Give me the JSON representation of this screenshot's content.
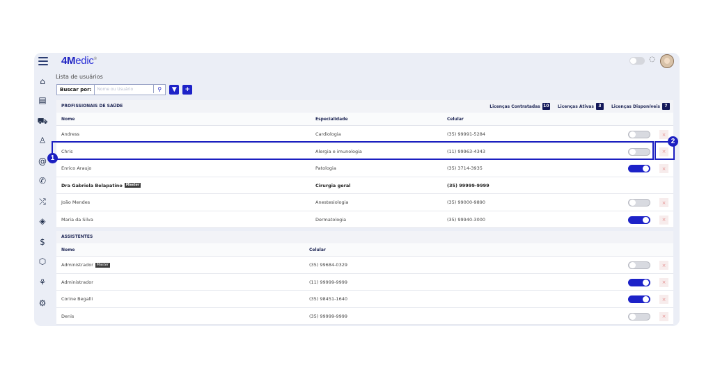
{
  "app": {
    "logo_bold": "4M",
    "logo_rest": "edic",
    "page_title": "Lista de usuários"
  },
  "sidebar": {
    "items": [
      {
        "icon": "home-icon",
        "glyph": "⌂"
      },
      {
        "icon": "calendar-icon",
        "glyph": "▤"
      },
      {
        "icon": "car-icon",
        "glyph": "⛟"
      },
      {
        "icon": "user-icon",
        "glyph": "♙"
      },
      {
        "icon": "at-icon",
        "glyph": "@"
      },
      {
        "icon": "phone-icon",
        "glyph": "✆"
      },
      {
        "icon": "shuffle-icon",
        "glyph": "⤮"
      },
      {
        "icon": "tag-icon",
        "glyph": "◈"
      },
      {
        "icon": "dollar-icon",
        "glyph": "$"
      },
      {
        "icon": "box-icon",
        "glyph": "⬡"
      },
      {
        "icon": "chart-icon",
        "glyph": "⚘"
      },
      {
        "icon": "settings-icon",
        "glyph": "⚙"
      }
    ]
  },
  "search": {
    "label": "Buscar por:",
    "placeholder": "Nome ou Usuário",
    "value": ""
  },
  "professionals": {
    "title": "PROFISSIONAIS DE SAÚDE",
    "licenses": [
      {
        "label": "Licenças Contratadas",
        "count": "10"
      },
      {
        "label": "Licenças Ativas",
        "count": "3"
      },
      {
        "label": "Licenças Disponíveis",
        "count": "7"
      }
    ],
    "columns": {
      "name": "Nome",
      "specialty": "Especialidade",
      "phone": "Celular"
    },
    "rows": [
      {
        "name": "Andress",
        "specialty": "Cardiologia",
        "phone": "(35) 99991-5284",
        "active": false,
        "master": false,
        "bold": false
      },
      {
        "name": "Chris",
        "specialty": "Alergia e imunologia",
        "phone": "(11) 99963-4343",
        "active": false,
        "master": false,
        "bold": false
      },
      {
        "name": "Enrico Araujo",
        "specialty": "Patologia",
        "phone": "(35) 3714-3935",
        "active": true,
        "master": false,
        "bold": false
      },
      {
        "name": "Dra Gabriela Belapatino",
        "specialty": "Cirurgia geral",
        "phone": "(35) 99999-9999",
        "active": null,
        "master": true,
        "bold": true
      },
      {
        "name": "João Mendes",
        "specialty": "Anestesiologia",
        "phone": "(35) 99000-9890",
        "active": false,
        "master": false,
        "bold": false
      },
      {
        "name": "Maria da Silva",
        "specialty": "Dermatologia",
        "phone": "(35) 99940-3000",
        "active": true,
        "master": false,
        "bold": false
      }
    ]
  },
  "assistants": {
    "title": "ASSISTENTES",
    "columns": {
      "name": "Nome",
      "phone": "Celular"
    },
    "rows": [
      {
        "name": "Administrador",
        "phone": "(35) 99684-0329",
        "active": false,
        "master": true
      },
      {
        "name": "Administrador",
        "phone": "(11) 99999-9999",
        "active": true,
        "master": false
      },
      {
        "name": "Corine Begalli",
        "phone": "(35) 98451-1640",
        "active": true,
        "master": false
      },
      {
        "name": "Denis",
        "phone": "(35) 99999-9999",
        "active": false,
        "master": false
      }
    ]
  },
  "labels": {
    "master_badge": "Master",
    "delete_glyph": "×"
  },
  "annotations": [
    {
      "number": "1"
    },
    {
      "number": "2"
    }
  ],
  "colors": {
    "accent": "#1b1fc1",
    "toggle_on": "#1d22c8",
    "license_badge": "#14195a"
  }
}
